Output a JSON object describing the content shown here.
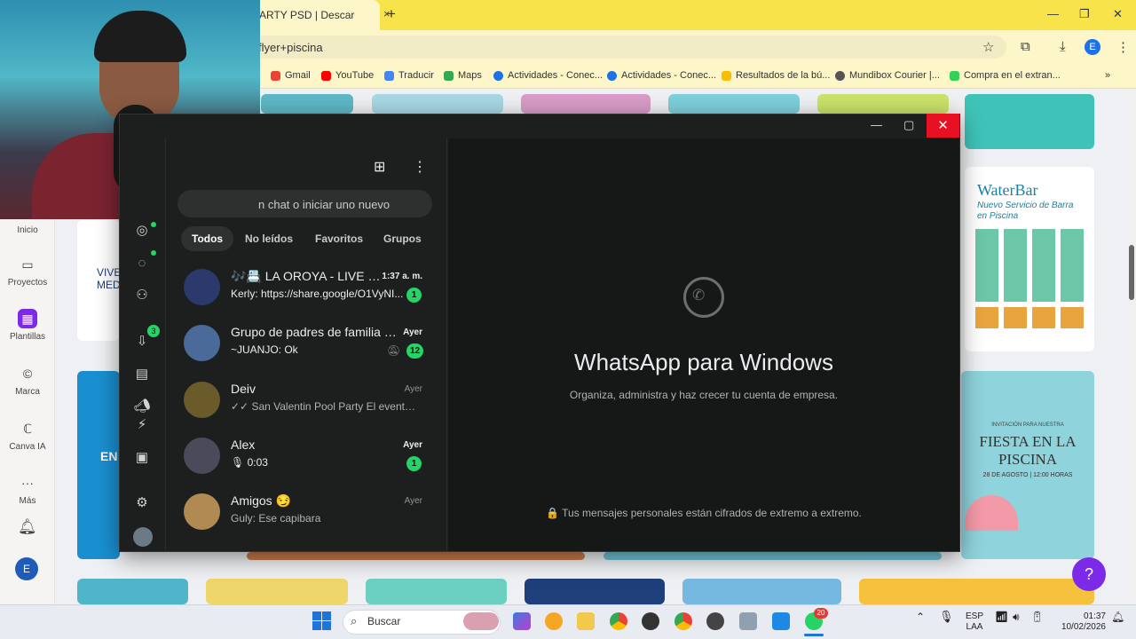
{
  "browser": {
    "tab_title": "ARTY PSD | Descarga gr",
    "tab_close": "×",
    "new_tab": "+",
    "url": "flyer+piscina",
    "window_controls": [
      "—",
      "❐",
      "✕"
    ],
    "toolbar_icons": [
      "star-icon",
      "extensions-icon",
      "download-icon",
      "profile-avatar",
      "menu-icon"
    ],
    "profile_initial": "E",
    "bookmarks": [
      {
        "label": "Gmail",
        "color": "#ea4335"
      },
      {
        "label": "YouTube",
        "color": "#ff0000"
      },
      {
        "label": "Traducir",
        "color": "#4285f4"
      },
      {
        "label": "Maps",
        "color": "#34a853"
      },
      {
        "label": "Actividades - Conec...",
        "color": "#1a73e8"
      },
      {
        "label": "Actividades - Conec...",
        "color": "#1a73e8"
      },
      {
        "label": "Resultados de la bú...",
        "color": "#fbbc04"
      },
      {
        "label": "Mundibox Courier |...",
        "color": "#555555"
      },
      {
        "label": "Compra en el extran...",
        "color": "#34d058"
      }
    ],
    "bookmarks_more": "»"
  },
  "canva": {
    "rail": [
      {
        "label": "Inicio"
      },
      {
        "label": "Proyectos",
        "icon": "▭"
      },
      {
        "label": "Plantillas",
        "icon": "▦"
      },
      {
        "label": "Marca",
        "icon": "©"
      },
      {
        "label": "Canva IA",
        "icon": "ℂ"
      },
      {
        "label": "Más",
        "icon": "···"
      }
    ],
    "avatar_initial": "E",
    "help": "?",
    "flyer_waterbar": {
      "title": "WaterBar",
      "subtitle": "Nuevo Servicio de Barra en Piscina"
    },
    "flyer_fiesta": {
      "kicker": "INVITACIÓN PARA NUESTRA",
      "title": "FIESTA EN LA PISCINA",
      "date": "28 DE AGOSTO | 12:00 HORAS"
    },
    "flyer_left": {
      "title": "VIVE MED",
      "title2": "EN"
    }
  },
  "whatsapp": {
    "window_controls": [
      "—",
      "▢",
      "✕"
    ],
    "search_placeholder": "n chat o iniciar uno nuevo",
    "filters": [
      "Todos",
      "No leídos",
      "Favoritos",
      "Grupos"
    ],
    "rail_badge": "3",
    "chats": [
      {
        "name": "🎶📇 LA OROYA - LIVE EV...",
        "time": "1:37 a. m.",
        "message": "Kerly: https://share.google/O1VyNI...",
        "unread": "1",
        "time_unread": true,
        "avatar": "#2b3a6b"
      },
      {
        "name": "Grupo de padres de familia de...",
        "time": "Ayer",
        "message": "~JUANJO: Ok",
        "unread": "12",
        "time_unread": true,
        "muted": true,
        "avatar": "#4a6a9a"
      },
      {
        "name": "Deiv",
        "time": "Ayer",
        "message": "✓✓ San Valentin Pool Party  El evento e...",
        "avatar": "#6b5a2a"
      },
      {
        "name": "Alex",
        "time": "Ayer",
        "message": "🎙 0:03",
        "unread": "1",
        "time_unread": true,
        "avatar": "#4a4a5a"
      },
      {
        "name": "Amigos 😏",
        "time": "Ayer",
        "message": "Guly: Ese capibara",
        "avatar": "#b08a52"
      }
    ],
    "main_title": "WhatsApp para Windows",
    "main_subtitle": "Organiza, administra y haz crecer tu cuenta de empresa.",
    "encryption_note": "🔒 Tus mensajes personales están cifrados de extremo a extremo."
  },
  "taskbar": {
    "search_label": "Buscar",
    "whatsapp_badge": "20",
    "lang": "ESP",
    "layout": "LAA",
    "time": "01:37",
    "date": "10/02/2026"
  }
}
